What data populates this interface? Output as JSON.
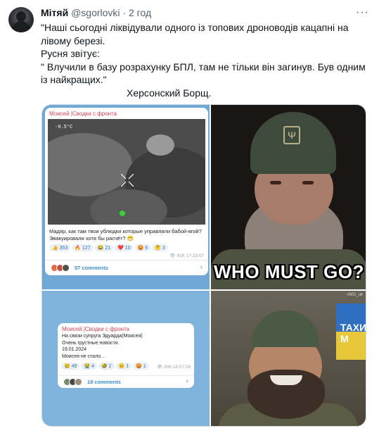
{
  "tweet": {
    "author_name": "Мітяй",
    "handle": "@sgorlovki",
    "separator": "·",
    "time": "2 год",
    "more_icon": "ellipsis-icon",
    "lines": [
      "\"Наші сьогодні ліквідували одного із топових дроноводів кацапні на",
      "лівому березі.",
      "Русня звітує:",
      "\" Влучили в базу розрахунку БПЛ, там не тільки він загинув. Був одним",
      "із найкращих.\""
    ],
    "signature": "Херсонский Борщ."
  },
  "media": {
    "card1": {
      "channel": "Моисей |Сводки с фронта",
      "hud_temp": "-9.5°C",
      "message": "Мадяр, как там твои ублюдки которые управляли бабой-ягой? Эвакуировали хотя бы расчёт? 😁",
      "reactions": [
        "👍 353",
        "🔥 127",
        "😂 21",
        "❤️ 10",
        "😡 6",
        "🤔 3"
      ],
      "views": "👁 91K  17:19:07",
      "comments": "57 comments"
    },
    "meme": {
      "caption": "WHO MUST GO?"
    },
    "card2": {
      "channel": "Моисей |Сводки с фронта",
      "lines": [
        "На связи супруга Эдуарда(Моисея)",
        "Очень грустные новости.",
        "19.01.2024",
        "Моисея не стало..."
      ],
      "reactions": [
        "😢 49",
        "😭 4",
        "🤣 2",
        "😐 1",
        "😡 1"
      ],
      "views": "👁 306  18:57:26",
      "comments": "18 comments"
    },
    "photo": {
      "watermark": "#MG_uk",
      "flag_text": "ТАХИ М"
    }
  }
}
